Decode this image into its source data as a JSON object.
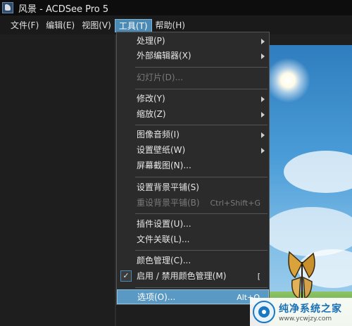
{
  "window": {
    "title": "风景 - ACDSee Pro 5"
  },
  "menubar": {
    "items": [
      {
        "label": "文件(F)"
      },
      {
        "label": "编辑(E)"
      },
      {
        "label": "视图(V)"
      },
      {
        "label": "工具(T)"
      },
      {
        "label": "帮助(H)"
      }
    ]
  },
  "tools_menu": {
    "items": {
      "process": {
        "label": "处理(P)"
      },
      "external_editors": {
        "label": "外部编辑器(X)"
      },
      "slideshow": {
        "label": "幻灯片(D)..."
      },
      "modify": {
        "label": "修改(Y)"
      },
      "zoom": {
        "label": "缩放(Z)"
      },
      "image_audio": {
        "label": "图像音频(I)"
      },
      "set_wallpaper": {
        "label": "设置壁纸(W)"
      },
      "screen_capture": {
        "label": "屏幕截图(N)..."
      },
      "set_bg_tile": {
        "label": "设置背景平铺(S)"
      },
      "reset_bg_tile": {
        "label": "重设背景平铺(B)",
        "shortcut": "Ctrl+Shift+G"
      },
      "plugin_settings": {
        "label": "插件设置(U)..."
      },
      "file_assoc": {
        "label": "文件关联(L)..."
      },
      "color_mgmt": {
        "label": "颜色管理(C)..."
      },
      "toggle_color_mgmt": {
        "label": "启用 / 禁用颜色管理(M)",
        "shortcut": "["
      },
      "options": {
        "label": "选项(O)...",
        "shortcut": "Alt+O"
      }
    }
  },
  "watermark": {
    "title": "纯净系统之家",
    "url": "www.ycwjzy.com"
  },
  "colors": {
    "accent": "#4a8ab5",
    "menu_bg": "#2b2b2b",
    "highlight": "#5a99c4"
  }
}
